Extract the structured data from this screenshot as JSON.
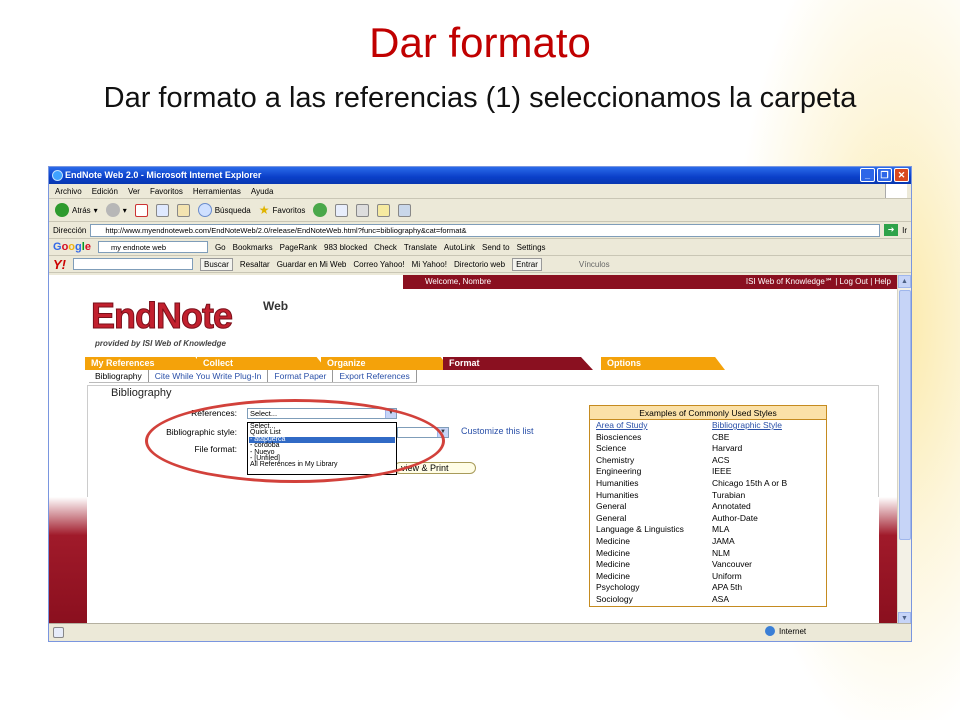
{
  "slide": {
    "title": "Dar formato",
    "subtitle": "Dar formato a las referencias (1) seleccionamos la carpeta"
  },
  "window": {
    "title": "EndNote Web 2.0 - Microsoft Internet Explorer"
  },
  "menu": [
    "Archivo",
    "Edición",
    "Ver",
    "Favoritos",
    "Herramientas",
    "Ayuda"
  ],
  "toolbar": {
    "back": "Atrás",
    "search": "Búsqueda",
    "favorites": "Favoritos"
  },
  "address": {
    "label": "Dirección",
    "url": "http://www.myendnoteweb.com/EndNoteWeb/2.0/release/EndNoteWeb.html?func=bibliography&cat=format&",
    "go": "Ir"
  },
  "google": {
    "logo": [
      "G",
      "o",
      "o",
      "g",
      "l",
      "e"
    ],
    "query": "my endnote web",
    "go": "Go",
    "bookmarks": "Bookmarks",
    "pagerank": "PageRank",
    "blocked": "983 blocked",
    "check": "Check",
    "translate": "Translate",
    "autolink": "AutoLink",
    "sendto": "Send to",
    "settings": "Settings"
  },
  "yahoo": {
    "logo": "Y!",
    "buscar": "Buscar",
    "resaltar": "Resaltar",
    "guardar": "Guardar en Mi Web",
    "correo": "Correo Yahoo!",
    "mi": "Mi Yahoo!",
    "directorio": "Directorio web",
    "entrar": "Entrar",
    "vinculos": "Vínculos"
  },
  "endnote": {
    "welcome": "Welcome, Nombre",
    "links": "ISI Web of Knowledge℠  |  Log Out  |  Help",
    "logo": "EndNote",
    "web": "Web",
    "by": "provided by ISI Web of Knowledge",
    "tabs": [
      "My References",
      "Collect",
      "Organize",
      "Format",
      "Options"
    ],
    "subtabs": [
      "Bibliography",
      "Cite While You Write Plug-In",
      "Format Paper",
      "Export References"
    ],
    "panel_title": "Bibliography",
    "references_label": "References:",
    "references_value": "Select...",
    "style_label": "Bibliographic style:",
    "fileformat_label": "File format:",
    "customize": "Customize this list",
    "preview": "view & Print",
    "dropdown": [
      "Select...",
      "Quick List",
      "- atapuerca",
      "- cordoba",
      "- Nuevo",
      "- [Unfiled]",
      "All References in My Library"
    ],
    "styles_title": "Examples of Commonly Used Styles",
    "styles_headers": [
      "Area of Study",
      "Bibliographic Style"
    ],
    "styles": [
      [
        "Biosciences",
        "CBE"
      ],
      [
        "Science",
        "Harvard"
      ],
      [
        "Chemistry",
        "ACS"
      ],
      [
        "Engineering",
        "IEEE"
      ],
      [
        "Humanities",
        "Chicago 15th A or B"
      ],
      [
        "Humanities",
        "Turabian"
      ],
      [
        "General",
        "Annotated"
      ],
      [
        "General",
        "Author-Date"
      ],
      [
        "Language & Linguistics",
        "MLA"
      ],
      [
        "Medicine",
        "JAMA"
      ],
      [
        "Medicine",
        "NLM"
      ],
      [
        "Medicine",
        "Vancouver"
      ],
      [
        "Medicine",
        "Uniform"
      ],
      [
        "Psychology",
        "APA 5th"
      ],
      [
        "Sociology",
        "ASA"
      ]
    ]
  },
  "status": {
    "zone": "Internet"
  }
}
